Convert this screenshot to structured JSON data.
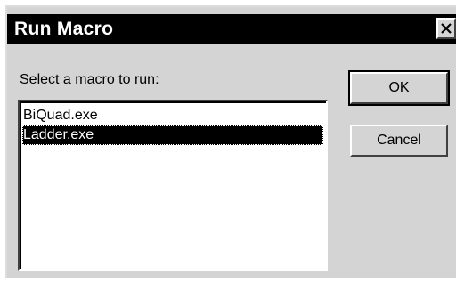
{
  "window": {
    "title": "Run Macro",
    "close_label": "close"
  },
  "prompt_label": "Select a macro to run:",
  "macros": {
    "items": [
      {
        "label": "BiQuad.exe",
        "selected": false
      },
      {
        "label": "Ladder.exe",
        "selected": true
      }
    ]
  },
  "buttons": {
    "ok_label": "OK",
    "cancel_label": "Cancel"
  },
  "colors": {
    "dialog_bg": "#d4d4d4",
    "titlebar_bg": "#000000",
    "title_text": "#ffffff",
    "selection_bg": "#000000",
    "selection_text": "#ffffff"
  }
}
